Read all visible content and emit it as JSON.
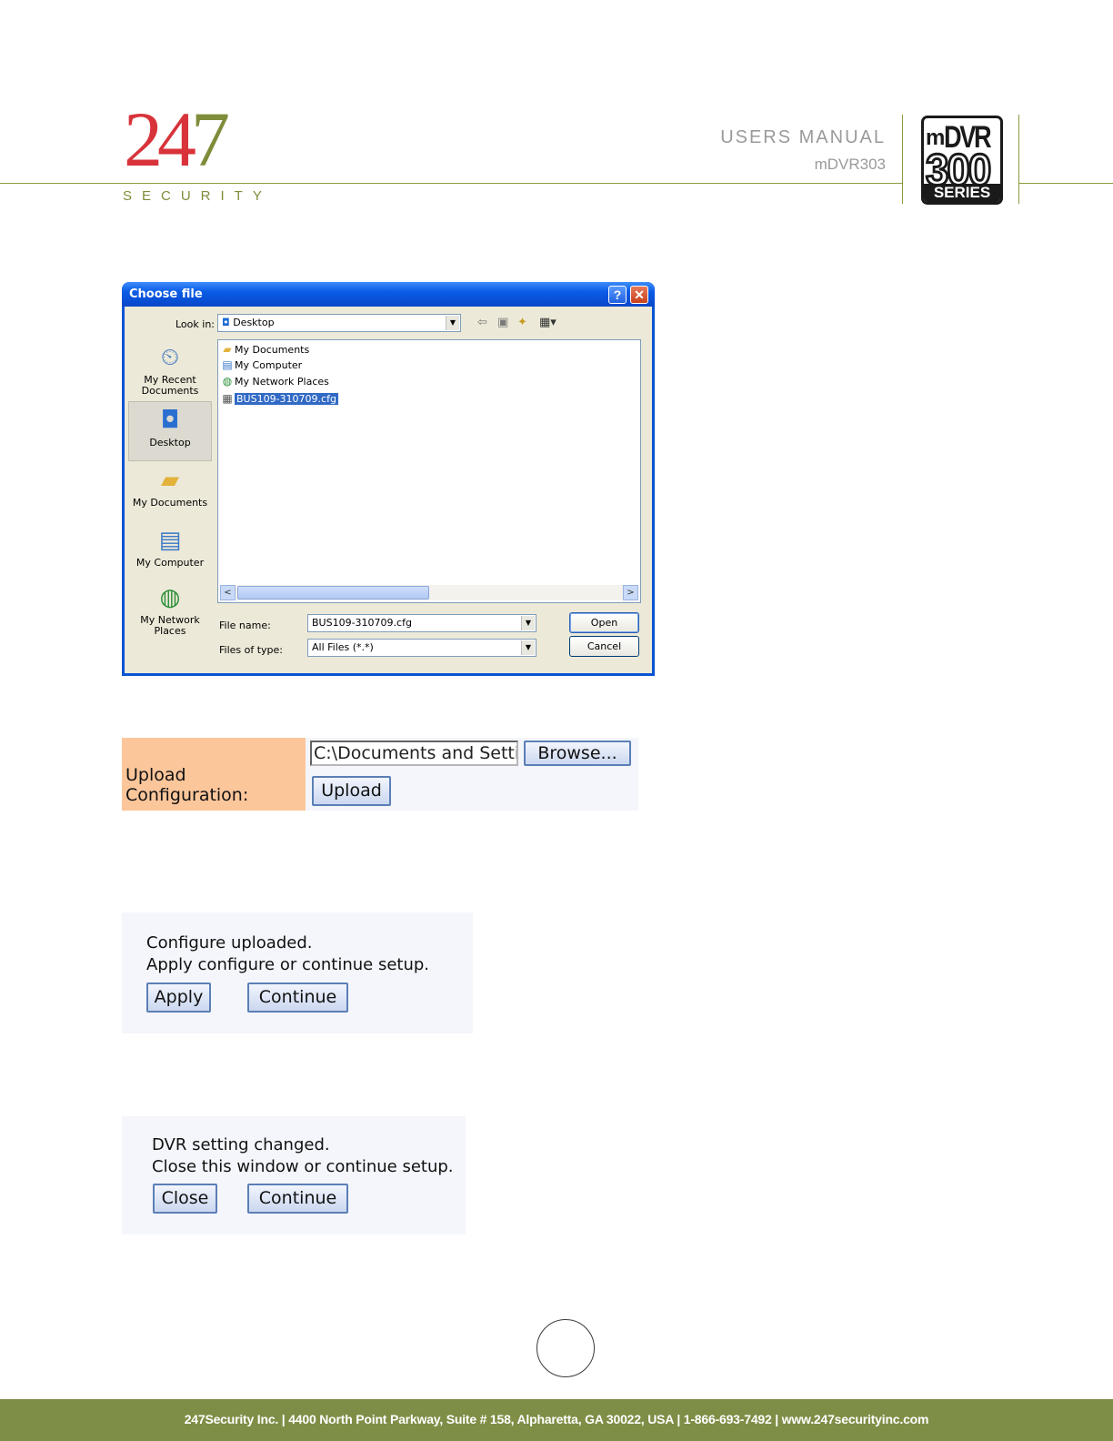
{
  "header": {
    "logo_num_red": "24",
    "logo_num_green": "7",
    "logo_word": "SECURITY",
    "manual_title": "USERS MANUAL",
    "manual_model": "mDVR303",
    "badge_m": "m",
    "badge_dvr": "DVR",
    "badge_num": "300",
    "badge_series": "SERIES"
  },
  "dialog": {
    "title": "Choose file",
    "help_glyph": "?",
    "close_glyph": "✕",
    "look_in_label": "Look in:",
    "look_in_value": "Desktop",
    "places": [
      {
        "label": "My Recent Documents",
        "icon": "recent-documents-icon"
      },
      {
        "label": "Desktop",
        "icon": "desktop-icon"
      },
      {
        "label": "My Documents",
        "icon": "my-documents-icon"
      },
      {
        "label": "My Computer",
        "icon": "my-computer-icon"
      },
      {
        "label": "My Network Places",
        "icon": "network-places-icon"
      }
    ],
    "files": [
      {
        "name": "My Documents",
        "icon": "folder-icon"
      },
      {
        "name": "My Computer",
        "icon": "computer-icon"
      },
      {
        "name": "My Network Places",
        "icon": "network-icon"
      },
      {
        "name": "BUS109-310709.cfg",
        "icon": "file-icon"
      }
    ],
    "file_name_label": "File name:",
    "file_name_value": "BUS109-310709.cfg",
    "file_type_label": "Files of type:",
    "file_type_value": "All Files (*.*)",
    "open_label": "Open",
    "cancel_label": "Cancel"
  },
  "upload": {
    "label": "Upload Configuration:",
    "path_value": "C:\\Documents and Setting",
    "browse_label": "Browse...",
    "upload_label": "Upload"
  },
  "configure_msg": {
    "line1": "Configure uploaded.",
    "line2": "Apply configure or continue setup.",
    "apply_label": "Apply",
    "continue_label": "Continue"
  },
  "changed_msg": {
    "line1": "DVR setting changed.",
    "line2": "Close this window or continue setup.",
    "close_label": "Close",
    "continue_label": "Continue"
  },
  "footer": {
    "text": "247Security Inc. | 4400 North Point Parkway, Suite # 158, Alpharetta, GA  30022,  USA  | 1-866-693-7492   | www.247securityinc.com"
  },
  "colors": {
    "brand_red": "#d8333a",
    "brand_green": "#7e8e46",
    "label_bg": "#fcc69b",
    "selection": "#316ac5"
  }
}
